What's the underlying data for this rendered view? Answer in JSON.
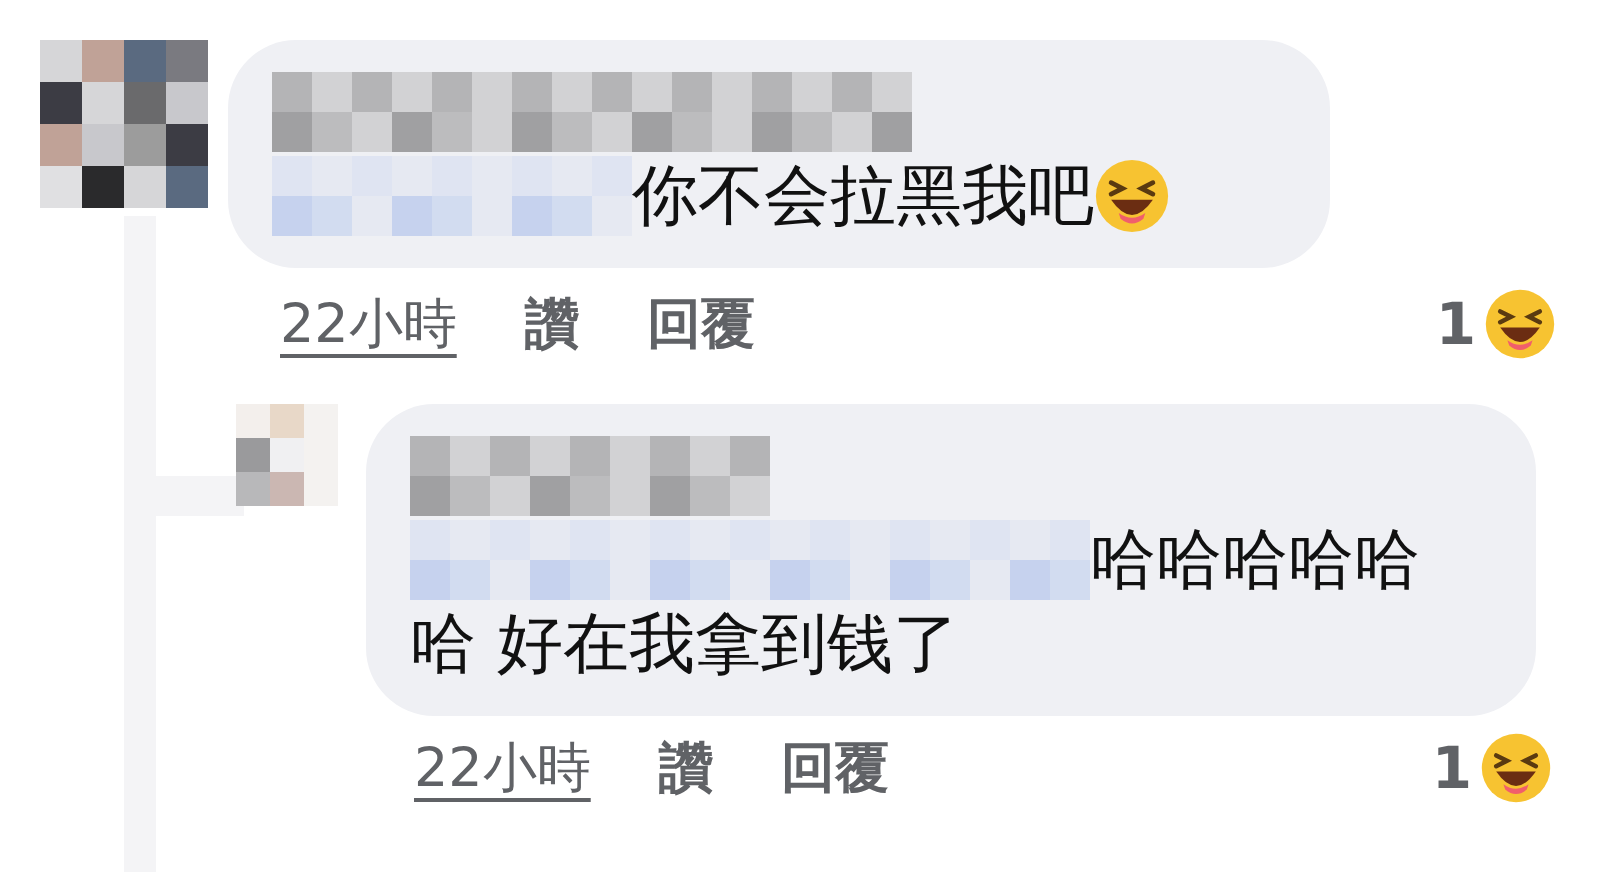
{
  "comments": [
    {
      "lines": [
        "你不会拉黑我吧"
      ],
      "ends_with_emoji": true,
      "time": "22小時",
      "like": "讚",
      "reply": "回覆",
      "reaction_count": "1",
      "replies": [
        {
          "lines": [
            "哈哈哈哈哈",
            "哈 好在我拿到钱了"
          ],
          "ends_with_emoji": false,
          "time": "22小時",
          "like": "讚",
          "reply": "回覆",
          "reaction_count": "1"
        }
      ]
    }
  ]
}
